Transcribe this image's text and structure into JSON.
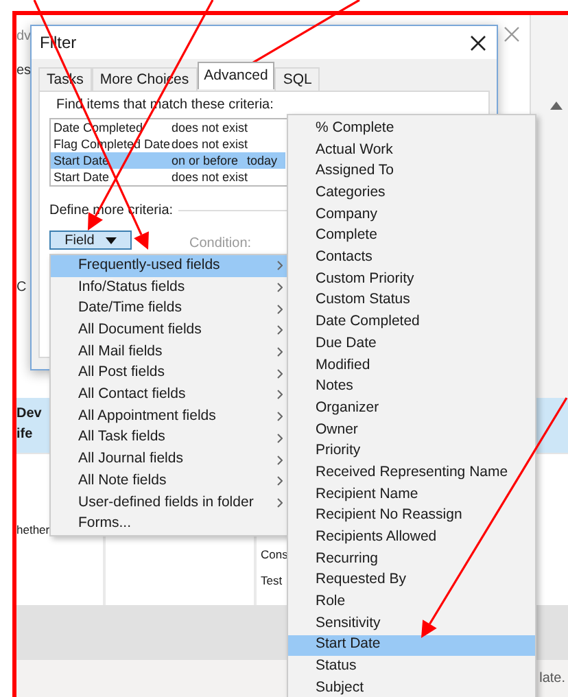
{
  "app_background": {
    "header_fragment": "dv",
    "side_fragment": "es",
    "side_fragment_2": "C",
    "list_item": {
      "title": "Dev",
      "subtitle": "ife"
    },
    "row_fragment": "hether",
    "column_items": [
      "Cons",
      "Test"
    ],
    "status_fragment": "late."
  },
  "dialog": {
    "title": "Filter",
    "tabs": [
      {
        "label": "Tasks",
        "selected": false
      },
      {
        "label": "More Choices",
        "selected": false
      },
      {
        "label": "Advanced",
        "selected": true
      },
      {
        "label": "SQL",
        "selected": false
      }
    ],
    "criteria_label": "Find items that match these criteria:",
    "criteria": [
      {
        "field": "Date Completed",
        "condition": "does not exist",
        "selected": false
      },
      {
        "field": "Flag Completed Date",
        "condition": "does not exist",
        "selected": false
      },
      {
        "field": "Start Date",
        "condition": "on or before",
        "value": "today",
        "selected": true
      },
      {
        "field": "Start Date",
        "condition": "does not exist",
        "selected": false
      }
    ],
    "define_label": "Define more criteria:",
    "field_button": "Field",
    "condition_label": "Condition:"
  },
  "field_menu": {
    "items": [
      {
        "label": "Frequently-used fields",
        "has_submenu": true,
        "selected": true
      },
      {
        "label": "Info/Status fields",
        "has_submenu": true,
        "selected": false
      },
      {
        "label": "Date/Time fields",
        "has_submenu": true,
        "selected": false
      },
      {
        "label": "All Document fields",
        "has_submenu": true,
        "selected": false
      },
      {
        "label": "All Mail fields",
        "has_submenu": true,
        "selected": false
      },
      {
        "label": "All Post fields",
        "has_submenu": true,
        "selected": false
      },
      {
        "label": "All Contact fields",
        "has_submenu": true,
        "selected": false
      },
      {
        "label": "All Appointment fields",
        "has_submenu": true,
        "selected": false
      },
      {
        "label": "All Task fields",
        "has_submenu": true,
        "selected": false
      },
      {
        "label": "All Journal fields",
        "has_submenu": true,
        "selected": false
      },
      {
        "label": "All Note fields",
        "has_submenu": true,
        "selected": false
      },
      {
        "label": "User-defined fields in folder",
        "has_submenu": true,
        "selected": false
      },
      {
        "label": "Forms...",
        "has_submenu": false,
        "selected": false
      }
    ]
  },
  "submenu": {
    "items": [
      {
        "label": "% Complete",
        "selected": false
      },
      {
        "label": "Actual Work",
        "selected": false
      },
      {
        "label": "Assigned To",
        "selected": false
      },
      {
        "label": "Categories",
        "selected": false
      },
      {
        "label": "Company",
        "selected": false
      },
      {
        "label": "Complete",
        "selected": false
      },
      {
        "label": "Contacts",
        "selected": false
      },
      {
        "label": "Custom Priority",
        "selected": false
      },
      {
        "label": "Custom Status",
        "selected": false
      },
      {
        "label": "Date Completed",
        "selected": false
      },
      {
        "label": "Due Date",
        "selected": false
      },
      {
        "label": "Modified",
        "selected": false
      },
      {
        "label": "Notes",
        "selected": false
      },
      {
        "label": "Organizer",
        "selected": false
      },
      {
        "label": "Owner",
        "selected": false
      },
      {
        "label": "Priority",
        "selected": false
      },
      {
        "label": "Received Representing Name",
        "selected": false
      },
      {
        "label": "Recipient Name",
        "selected": false
      },
      {
        "label": "Recipient No Reassign",
        "selected": false
      },
      {
        "label": "Recipients Allowed",
        "selected": false
      },
      {
        "label": "Recurring",
        "selected": false
      },
      {
        "label": "Requested By",
        "selected": false
      },
      {
        "label": "Role",
        "selected": false
      },
      {
        "label": "Sensitivity",
        "selected": false
      },
      {
        "label": "Start Date",
        "selected": true
      },
      {
        "label": "Status",
        "selected": false
      },
      {
        "label": "Subject",
        "selected": false
      }
    ]
  }
}
